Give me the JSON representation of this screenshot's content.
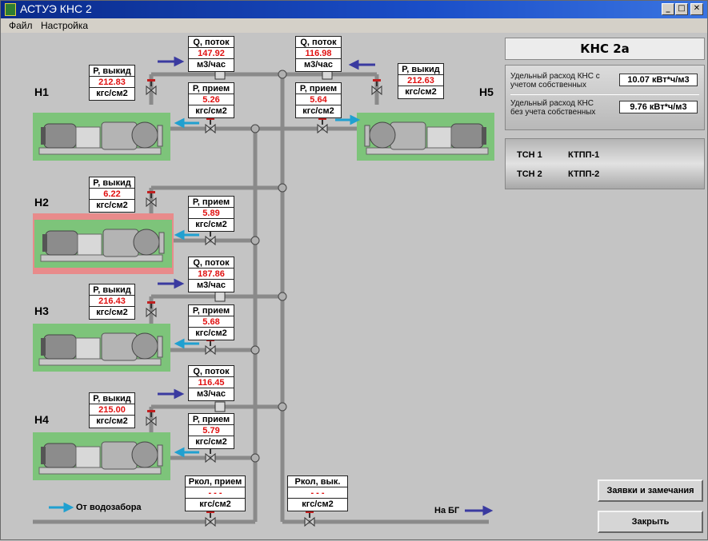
{
  "window": {
    "title": "АСТУЭ КНС 2"
  },
  "menu": {
    "file": "Файл",
    "settings": "Настройка"
  },
  "pumps": {
    "h1": {
      "label": "Н1",
      "state_color": "#7dc47a",
      "p_out_title": "P, выкид",
      "p_out": "212.83",
      "p_out_unit": "кгс/см2",
      "p_in_title": "P, прием",
      "p_in": "5.26",
      "p_in_unit": "кгс/см2",
      "q_title": "Q, поток",
      "q": "147.92",
      "q_unit": "м3/час"
    },
    "h5": {
      "label": "Н5",
      "state_color": "#7dc47a",
      "p_out_title": "P, выкид",
      "p_out": "212.63",
      "p_out_unit": "кгс/см2",
      "p_in_title": "P, прием",
      "p_in": "5.64",
      "p_in_unit": "кгс/см2",
      "q_title": "Q, поток",
      "q": "116.98",
      "q_unit": "м3/час"
    },
    "h2": {
      "label": "Н2",
      "state_color": "#e88b8b",
      "p_out_title": "P, выкид",
      "p_out": "6.22",
      "p_out_unit": "кгс/см2",
      "p_in_title": "P, прием",
      "p_in": "5.89",
      "p_in_unit": "кгс/см2"
    },
    "h3": {
      "label": "Н3",
      "state_color": "#7dc47a",
      "p_out_title": "P, выкид",
      "p_out": "216.43",
      "p_out_unit": "кгс/см2",
      "p_in_title": "P, прием",
      "p_in": "5.68",
      "p_in_unit": "кгс/см2",
      "q_title": "Q, поток",
      "q": "187.86",
      "q_unit": "м3/час"
    },
    "h4": {
      "label": "Н4",
      "state_color": "#7dc47a",
      "p_out_title": "P, выкид",
      "p_out": "215.00",
      "p_out_unit": "кгс/см2",
      "p_in_title": "P, прием",
      "p_in": "5.79",
      "p_in_unit": "кгс/см2",
      "q_title": "Q, поток",
      "q": "116.45",
      "q_unit": "м3/час"
    }
  },
  "collectors": {
    "in_title": "Pкол, прием",
    "in_value": "- - -",
    "in_unit": "кгс/см2",
    "out_title": "Pкол, вык.",
    "out_value": "- - -",
    "out_unit": "кгс/см2"
  },
  "legend": {
    "from_intake": "От водозабора",
    "to_bg": "На БГ"
  },
  "panel": {
    "title": "КНС 2а",
    "spec1_label_1": "Удельный расход КНС с",
    "spec1_label_2": "учетом собственных",
    "spec1_value": "10.07 кВт*ч/м3",
    "spec2_label_1": "Удельный расход КНС",
    "spec2_label_2": "без учета собственных",
    "spec2_value": "9.76 кВт*ч/м3",
    "tsn1": "ТСН 1",
    "ktp1": "КТПП-1",
    "tsn2": "ТСН 2",
    "ktp2": "КТПП-2"
  },
  "buttons": {
    "requests": "Заявки и замечания",
    "close": "Закрыть"
  },
  "colors": {
    "pipe": "#8a8a8a",
    "arrow_navy": "#3a3aa0",
    "arrow_cyan": "#20a0d0",
    "value_red": "#e01010"
  },
  "icons": {
    "minimize": "_",
    "maximize": "□",
    "close": "✕"
  }
}
